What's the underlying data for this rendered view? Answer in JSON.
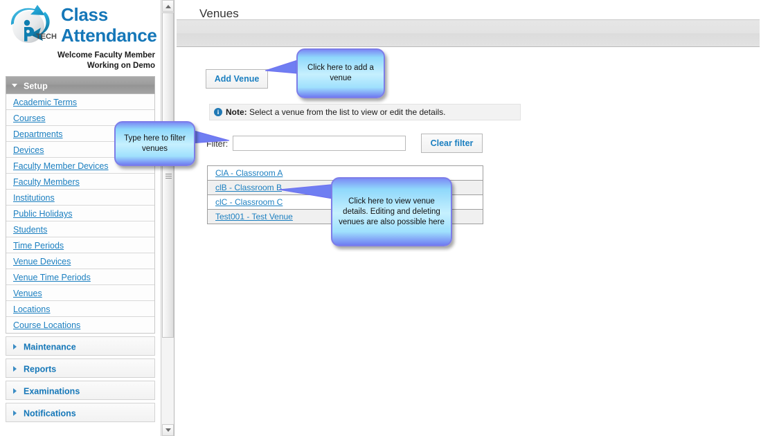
{
  "brand": {
    "title_line1": "Class",
    "title_line2": "Attendance",
    "welcome": "Welcome Faculty Member",
    "working": "Working on Demo",
    "logo_text": "TECH",
    "accent_color": "#1577b8"
  },
  "sidebar": {
    "setup_section": {
      "label": "Setup",
      "expanded": true,
      "items": [
        {
          "label": "Academic Terms"
        },
        {
          "label": "Courses"
        },
        {
          "label": "Departments"
        },
        {
          "label": "Devices"
        },
        {
          "label": "Faculty Member Devices"
        },
        {
          "label": "Faculty Members"
        },
        {
          "label": "Institutions"
        },
        {
          "label": "Public Holidays"
        },
        {
          "label": "Students"
        },
        {
          "label": "Time Periods"
        },
        {
          "label": "Venue Devices"
        },
        {
          "label": "Venue Time Periods"
        },
        {
          "label": "Venues"
        },
        {
          "label": "Locations"
        },
        {
          "label": "Course Locations"
        }
      ]
    },
    "collapsed_sections": [
      {
        "label": "Maintenance"
      },
      {
        "label": "Reports"
      },
      {
        "label": "Examinations"
      },
      {
        "label": "Notifications"
      }
    ]
  },
  "main": {
    "page_title": "Venues",
    "add_button_label": "Add Venue",
    "note": {
      "label": "Note:",
      "text": " Select a venue from the list to view or edit the details."
    },
    "filter": {
      "label": "Filter:",
      "value": "",
      "placeholder": "",
      "clear_button_label": "Clear filter"
    },
    "venue_list": [
      {
        "label": "ClA - Classroom A"
      },
      {
        "label": "clB - Classroom B"
      },
      {
        "label": "clC - Classroom C"
      },
      {
        "label": "Test001 - Test Venue"
      }
    ]
  },
  "callouts": {
    "add_venue": "Click here to add a venue",
    "filter": "Type here to filter venues",
    "venue_list": "Click here to view venue details. Editing and deleting venues are also possible here"
  }
}
